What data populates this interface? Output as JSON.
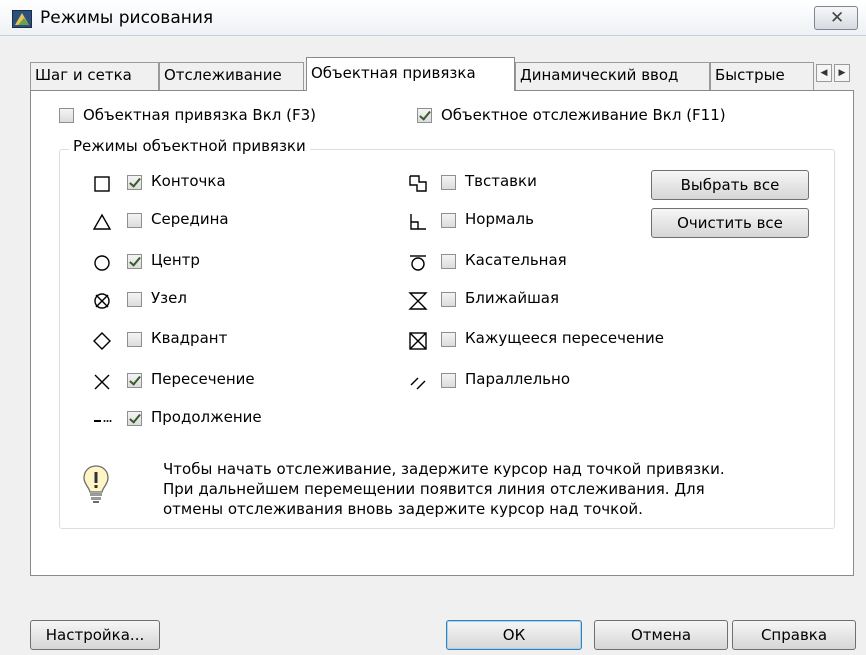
{
  "window": {
    "title": "Режимы рисования",
    "close_glyph": "✕"
  },
  "tabs": [
    {
      "label": "Шаг и сетка",
      "active": false
    },
    {
      "label": "Отслеживание",
      "active": false
    },
    {
      "label": "Объектная привязка",
      "active": true
    },
    {
      "label": "Динамический ввод",
      "active": false
    },
    {
      "label": "Быстрые",
      "active": false
    }
  ],
  "tab_scroll": {
    "left": "◀",
    "right": "▶"
  },
  "top_checks": {
    "snap_on": {
      "label": "Объектная привязка Вкл (F3)",
      "checked": false
    },
    "tracking_on": {
      "label": "Объектное отслеживание Вкл (F11)",
      "checked": true
    }
  },
  "group_title": "Режимы объектной привязки",
  "modes_left": [
    {
      "label": "Конточка",
      "checked": true,
      "icon": "endpoint-square-icon"
    },
    {
      "label": "Середина",
      "checked": false,
      "icon": "midpoint-triangle-icon"
    },
    {
      "label": "Центр",
      "checked": true,
      "icon": "center-circle-icon"
    },
    {
      "label": "Узел",
      "checked": false,
      "icon": "node-icon"
    },
    {
      "label": "Квадрант",
      "checked": false,
      "icon": "quadrant-diamond-icon"
    },
    {
      "label": "Пересечение",
      "checked": true,
      "icon": "intersection-x-icon"
    },
    {
      "label": "Продолжение",
      "checked": true,
      "icon": "extension-icon"
    }
  ],
  "modes_right": [
    {
      "label": "Твставки",
      "checked": false,
      "icon": "insertion-icon"
    },
    {
      "label": "Нормаль",
      "checked": false,
      "icon": "perpendicular-icon"
    },
    {
      "label": "Касательная",
      "checked": false,
      "icon": "tangent-icon"
    },
    {
      "label": "Ближайшая",
      "checked": false,
      "icon": "nearest-icon"
    },
    {
      "label": "Кажущееся пересечение",
      "checked": false,
      "icon": "apparent-intersection-icon"
    },
    {
      "label": "Параллельно",
      "checked": false,
      "icon": "parallel-icon"
    }
  ],
  "buttons": {
    "select_all": "Выбрать все",
    "clear_all": "Очистить все",
    "options": "Настройка...",
    "ok": "ОК",
    "cancel": "Отмена",
    "help": "Справка"
  },
  "hint": {
    "icon": "lightbulb-icon",
    "line1": "Чтобы начать отслеживание, задержите курсор над точкой привязки.",
    "line2": "При дальнейшем перемещении появится линия отслеживания. Для",
    "line3": "отмены отслеживания вновь задержите курсор над точкой."
  }
}
